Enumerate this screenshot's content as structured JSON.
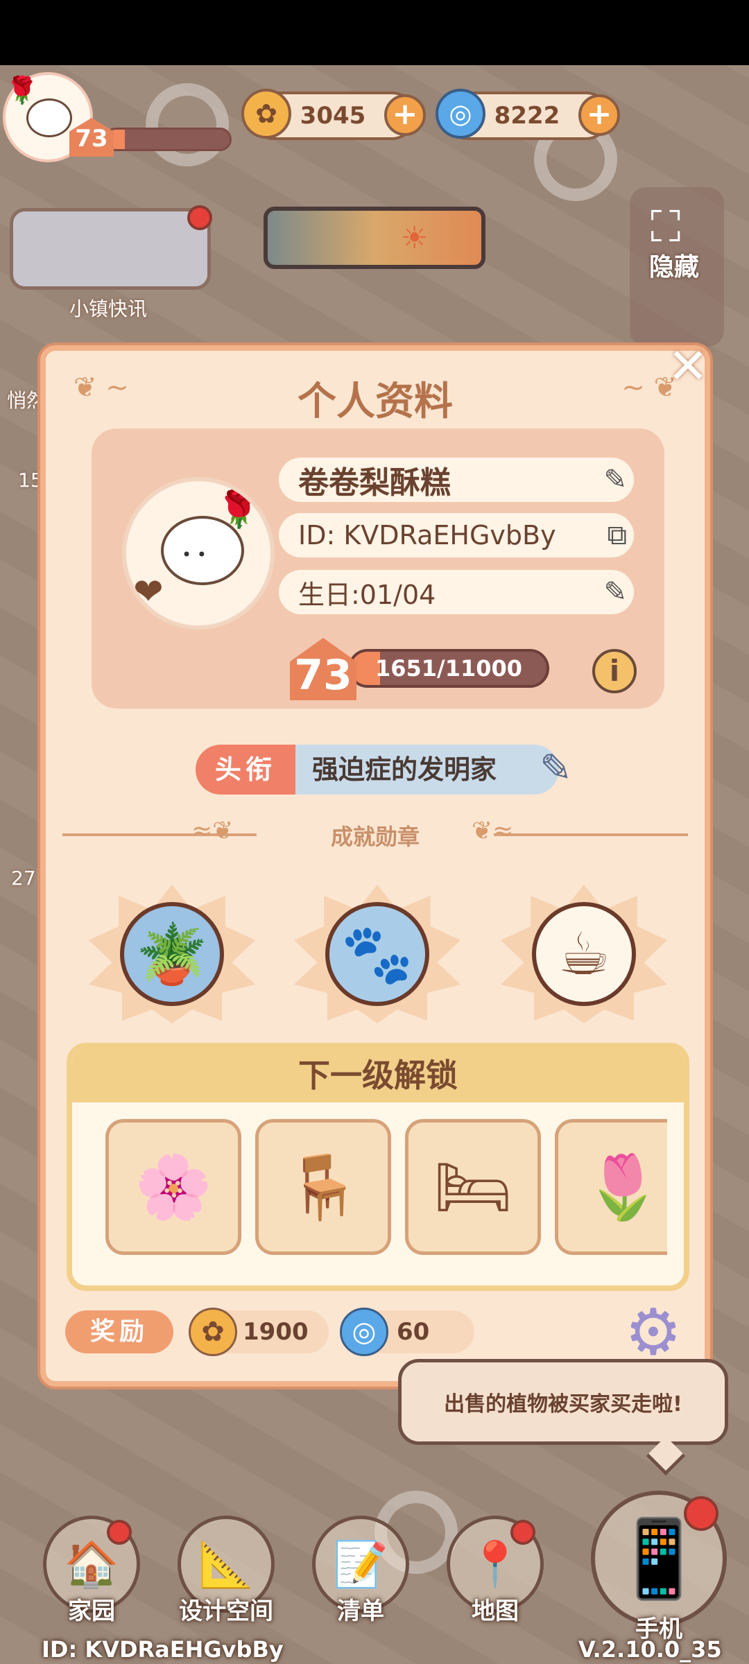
{
  "hud": {
    "player_level": "73",
    "player_xp_fraction": 0.15,
    "coins": "3045",
    "gems": "8222"
  },
  "left_panel": {
    "news_label": "小镇快讯",
    "hide_label": "隐藏",
    "partial_label_1": "悄然",
    "partial_label_2": "15",
    "partial_label_3": "27"
  },
  "profile": {
    "title": "个人资料",
    "name": "卷卷梨酥糕",
    "id": "ID: KVDRaEHGvbBy",
    "birthday": "生日:01/04",
    "level": "73",
    "xp_text": "1651/11000",
    "xp_fraction": 0.15,
    "title_tag": "头衔",
    "title_value": "强迫症的发明家",
    "achievements_label": "成就勋章",
    "badges": [
      {
        "name": "watering-can-badge",
        "glyph": "🪴"
      },
      {
        "name": "cat-paw-badge",
        "glyph": "🐾"
      },
      {
        "name": "coffee-cup-badge",
        "glyph": "☕"
      }
    ],
    "unlock_title": "下一级解锁",
    "unlock_items": [
      {
        "name": "flower-screen-item",
        "glyph": "🌸"
      },
      {
        "name": "tablecloth-table-item",
        "glyph": "🪑"
      },
      {
        "name": "bed-item",
        "glyph": "🛏"
      },
      {
        "name": "tulip-mug-item",
        "glyph": "🌷"
      }
    ],
    "reward_label": "奖励",
    "reward_coins": "1900",
    "reward_gems": "60"
  },
  "toast": {
    "text": "出售的植物被买家买走啦!"
  },
  "nav": {
    "items": [
      {
        "label": "家园",
        "glyph": "🏠"
      },
      {
        "label": "设计空间",
        "glyph": "📐"
      },
      {
        "label": "清单",
        "glyph": "📝"
      },
      {
        "label": "地图",
        "glyph": "📍"
      }
    ],
    "phone_label": "手机",
    "footer_id": "ID: KVDRaEHGvbBy",
    "version": "V.2.10.0_35"
  },
  "colors": {
    "accent": "#e9835a",
    "panel": "#fbe6d2",
    "border": "#f2b38a",
    "title_text": "#b4734c"
  }
}
